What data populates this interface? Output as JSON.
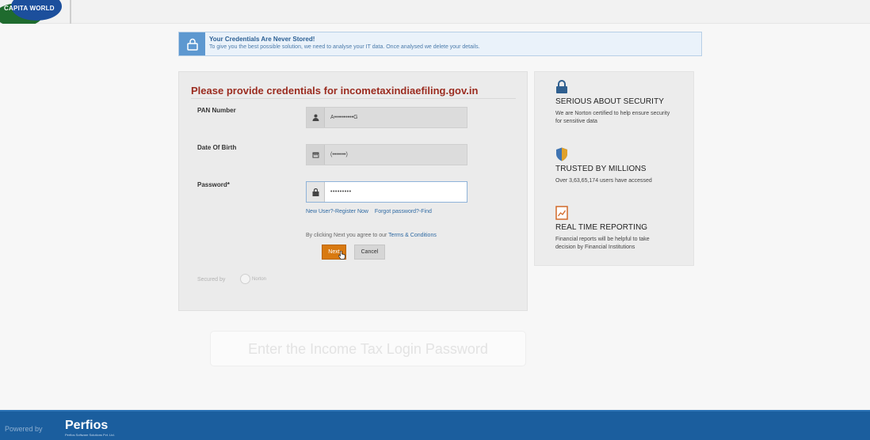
{
  "header": {
    "logo_text": "CAPITA WORLD"
  },
  "notice": {
    "title": "Your Credentials Are Never Stored!",
    "text": "To give you the best possible solution, we need to analyse your IT data. Once analysed we delete your details."
  },
  "form": {
    "title": "Please provide credentials for incometaxindiaefiling.gov.in",
    "fields": [
      {
        "label": "PAN Number",
        "value": "A••••••••••G",
        "icon": "user-icon"
      },
      {
        "label": "Date Of Birth",
        "value": "(•••••••)",
        "icon": "calendar-icon"
      },
      {
        "label": "Password*",
        "value": "•••••••••",
        "icon": "lock-icon"
      }
    ],
    "links": {
      "register": "New User?-Register Now",
      "forgot": "Forgot password?-Find"
    },
    "agreement": {
      "prefix": "By clicking Next you agree to our",
      "terms": "Terms & Conditions"
    },
    "buttons": {
      "next": "Next",
      "cancel": "Cancel"
    },
    "secured_by": "Secured by",
    "secured_brand": "Norton"
  },
  "side": {
    "items": [
      {
        "icon": "padlock-icon",
        "title": "SERIOUS ABOUT SECURITY",
        "text": "We are Norton certified to help ensure security for sensitive data"
      },
      {
        "icon": "shield-icon",
        "title": "TRUSTED BY MILLIONS",
        "text": "Over 3,63,65,174 users have accessed"
      },
      {
        "icon": "report-icon",
        "title": "REAL TIME REPORTING",
        "text": "Financial reports will be helpful to take decision by Financial Institutions"
      }
    ]
  },
  "overlay": {
    "ghost_text": "Enter the Income Tax Login Password"
  },
  "footer": {
    "powered_by": "Powered by",
    "brand": "Perfios",
    "brand_tagline": "Perfios Software Solutions Pvt. Ltd."
  },
  "colors": {
    "title_red": "#9b2c20",
    "next_orange": "#d87910",
    "footer_blue": "#1b5e9e",
    "notice_blue": "#5d98d0"
  }
}
